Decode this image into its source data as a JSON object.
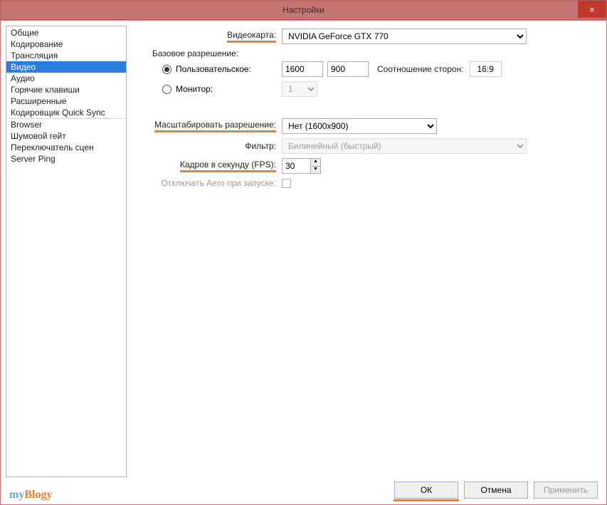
{
  "window": {
    "title": "Настройки",
    "close": "×"
  },
  "sidebar": {
    "items": [
      "Общие",
      "Кодирование",
      "Трансляция",
      "Видео",
      "Аудио",
      "Горячие клавиши",
      "Расширенные",
      "Кодировщик Quick Sync",
      "Browser",
      "Шумовой гейт",
      "Переключатель сцен",
      "Server Ping"
    ],
    "selected_index": 3,
    "separators_after": [
      7
    ]
  },
  "labels": {
    "videocard": "Видеокарта:",
    "base_res": "Базовое разрешение:",
    "custom": "Пользовательское:",
    "monitor": "Монитор:",
    "aspect": "Соотношение сторон:",
    "scale_res": "Масштабировать разрешение:",
    "filter": "Фильтр:",
    "fps": "Кадров в секунду (FPS):",
    "disable_aero": "Отключать Aero при запуске:"
  },
  "values": {
    "videocard": "NVIDIA GeForce GTX 770",
    "width": "1600",
    "height": "900",
    "aspect": "16:9",
    "monitor": "1",
    "scale_res": "Нет  (1600x900)",
    "filter": "Билинейный (быстрый)",
    "fps": "30",
    "radio_selected": "custom"
  },
  "buttons": {
    "ok": "ОК",
    "cancel": "Отмена",
    "apply": "Применить"
  },
  "watermark": {
    "a": "my",
    "b": "Blogy"
  }
}
